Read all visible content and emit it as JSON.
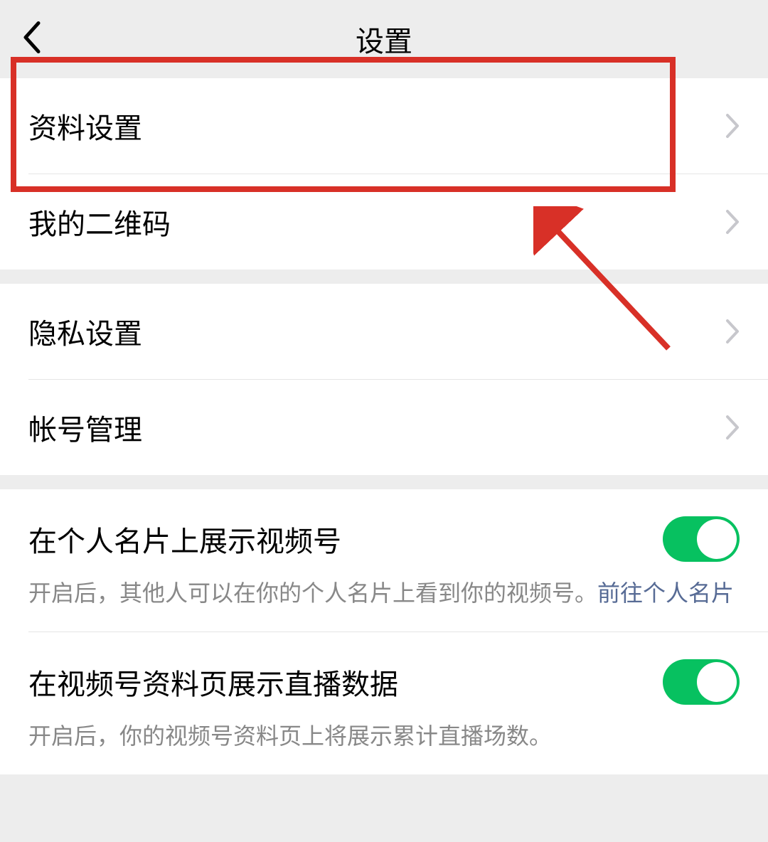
{
  "header": {
    "title": "设置"
  },
  "group1": {
    "items": [
      {
        "label": "资料设置",
        "name": "profile-settings-item"
      },
      {
        "label": "我的二维码",
        "name": "my-qrcode-item"
      }
    ]
  },
  "group2": {
    "items": [
      {
        "label": "隐私设置",
        "name": "privacy-settings-item"
      },
      {
        "label": "帐号管理",
        "name": "account-management-item"
      }
    ]
  },
  "group3": {
    "toggle1": {
      "label": "在个人名片上展示视频号",
      "desc": "开启后，其他人可以在你的个人名片上看到你的视频号。",
      "link": "前往个人名片",
      "on": true
    },
    "toggle2": {
      "label": "在视频号资料页展示直播数据",
      "desc": "开启后，你的视频号资料页上将展示累计直播场数。",
      "on": true
    }
  },
  "annotation": {
    "highlight_target": "profile-settings-item"
  }
}
